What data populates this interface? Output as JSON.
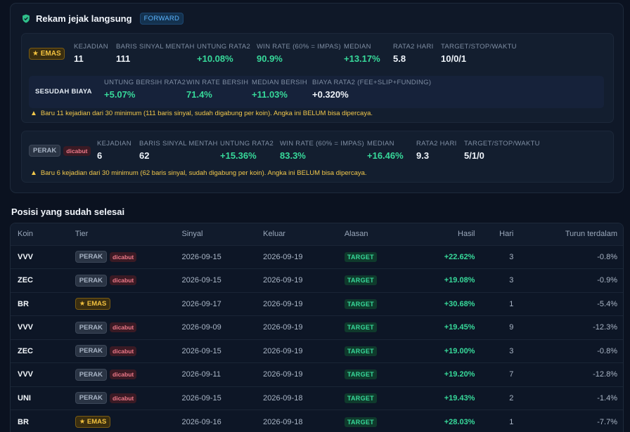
{
  "panel": {
    "title": "Rekam jejak langsung",
    "mode_badge": "FORWARD",
    "gold": {
      "tier_label": "★ EMAS",
      "stats": [
        {
          "label": "KEJADIAN",
          "value": "11"
        },
        {
          "label": "BARIS SINYAL MENTAH",
          "value": "111"
        },
        {
          "label": "UNTUNG RATA2",
          "value": "+10.08%"
        },
        {
          "label": "WIN RATE (60% = IMPAS)",
          "value": "90.9%"
        },
        {
          "label": "MEDIAN",
          "value": "+13.17%"
        },
        {
          "label": "RATA2 HARI",
          "value": "5.8"
        },
        {
          "label": "TARGET/STOP/WAKTU",
          "value": "10/0/1"
        }
      ],
      "after_fee": {
        "label": "SESUDAH BIAYA",
        "stats": [
          {
            "label": "UNTUNG BERSIH RATA2",
            "value": "+5.07%"
          },
          {
            "label": "WIN RATE BERSIH",
            "value": "71.4%"
          },
          {
            "label": "MEDIAN BERSIH",
            "value": "+11.03%"
          },
          {
            "label": "BIAYA RATA2 (FEE+SLIP+FUNDING)",
            "value": "+0.320%"
          }
        ]
      },
      "warning": "Baru 11 kejadian dari 30 minimum (111 baris sinyal, sudah digabung per koin). Angka ini BELUM bisa dipercaya."
    },
    "silver": {
      "tier_label": "PERAK",
      "status_tag": "dicabut",
      "stats": [
        {
          "label": "KEJADIAN",
          "value": "6"
        },
        {
          "label": "BARIS SINYAL MENTAH",
          "value": "62"
        },
        {
          "label": "UNTUNG RATA2",
          "value": "+15.36%"
        },
        {
          "label": "WIN RATE (60% = IMPAS)",
          "value": "83.3%"
        },
        {
          "label": "MEDIAN",
          "value": "+16.46%"
        },
        {
          "label": "RATA2 HARI",
          "value": "9.3"
        },
        {
          "label": "TARGET/STOP/WAKTU",
          "value": "5/1/0"
        }
      ],
      "warning": "Baru 6 kejadian dari 30 minimum (62 baris sinyal, sudah digabung per koin). Angka ini BELUM bisa dipercaya."
    }
  },
  "closed": {
    "title": "Posisi yang sudah selesai",
    "headers": [
      "Koin",
      "Tier",
      "Sinyal",
      "Keluar",
      "Alasan",
      "Hasil",
      "Hari",
      "Turun terdalam"
    ],
    "rows": [
      {
        "coin": "VVV",
        "tier": "PERAK",
        "tag": "dicabut",
        "signal": "2026-09-15",
        "exit": "2026-09-19",
        "reason": "TARGET",
        "result": "+22.62%",
        "days": "3",
        "drawdown": "-0.8%"
      },
      {
        "coin": "ZEC",
        "tier": "PERAK",
        "tag": "dicabut",
        "signal": "2026-09-15",
        "exit": "2026-09-19",
        "reason": "TARGET",
        "result": "+19.08%",
        "days": "3",
        "drawdown": "-0.9%"
      },
      {
        "coin": "BR",
        "tier": "★ EMAS",
        "tag": "",
        "signal": "2026-09-17",
        "exit": "2026-09-19",
        "reason": "TARGET",
        "result": "+30.68%",
        "days": "1",
        "drawdown": "-5.4%"
      },
      {
        "coin": "VVV",
        "tier": "PERAK",
        "tag": "dicabut",
        "signal": "2026-09-09",
        "exit": "2026-09-19",
        "reason": "TARGET",
        "result": "+19.45%",
        "days": "9",
        "drawdown": "-12.3%"
      },
      {
        "coin": "ZEC",
        "tier": "PERAK",
        "tag": "dicabut",
        "signal": "2026-09-15",
        "exit": "2026-09-19",
        "reason": "TARGET",
        "result": "+19.00%",
        "days": "3",
        "drawdown": "-0.8%"
      },
      {
        "coin": "VVV",
        "tier": "PERAK",
        "tag": "dicabut",
        "signal": "2026-09-11",
        "exit": "2026-09-19",
        "reason": "TARGET",
        "result": "+19.20%",
        "days": "7",
        "drawdown": "-12.8%"
      },
      {
        "coin": "UNI",
        "tier": "PERAK",
        "tag": "dicabut",
        "signal": "2026-09-15",
        "exit": "2026-09-18",
        "reason": "TARGET",
        "result": "+19.43%",
        "days": "2",
        "drawdown": "-1.4%"
      },
      {
        "coin": "BR",
        "tier": "★ EMAS",
        "tag": "",
        "signal": "2026-09-16",
        "exit": "2026-09-18",
        "reason": "TARGET",
        "result": "+28.03%",
        "days": "1",
        "drawdown": "-7.7%"
      }
    ]
  },
  "colors": {
    "accent_green": "#37d99a",
    "gold": "#f3c23f",
    "warning": "#f2c84b",
    "forward_blue": "#5cb4ff"
  }
}
